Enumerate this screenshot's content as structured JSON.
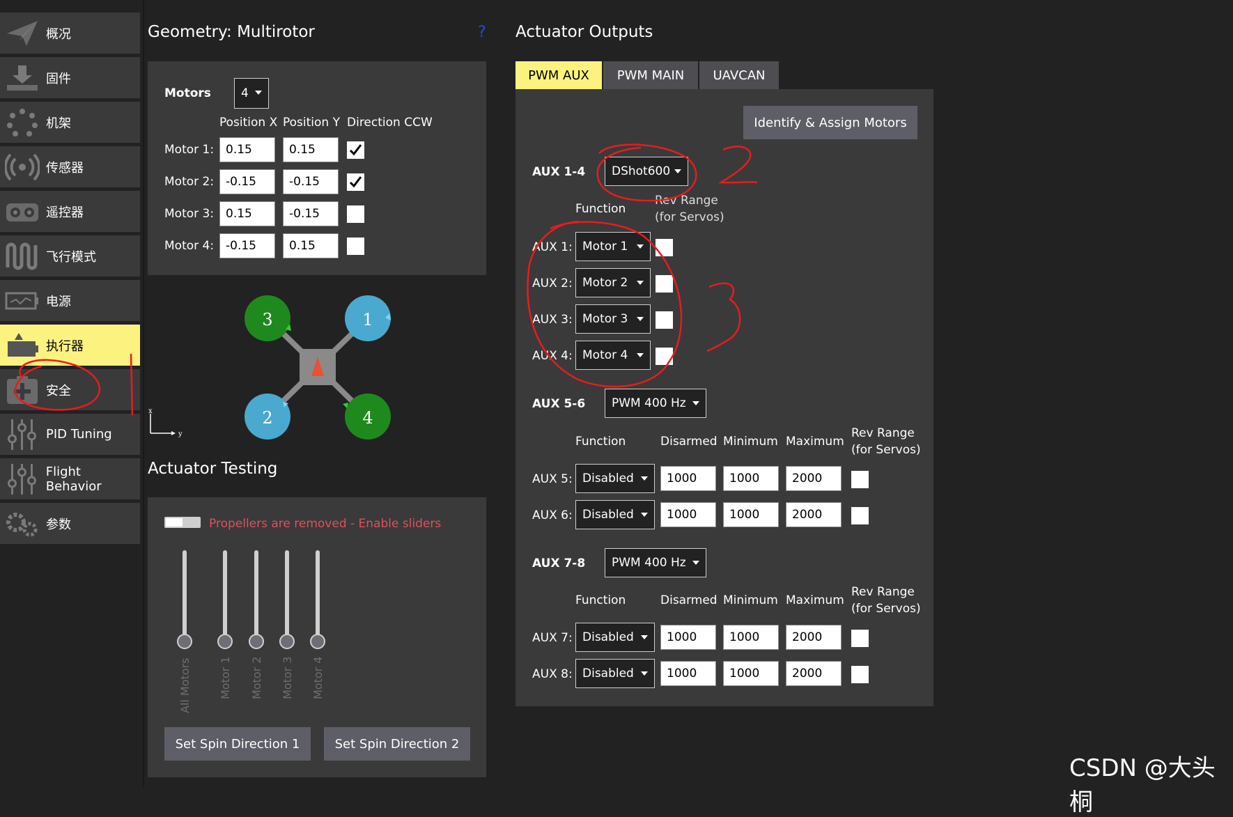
{
  "sidebar": {
    "items": [
      {
        "label": "概况",
        "icon": "paper-plane-icon"
      },
      {
        "label": "固件",
        "icon": "download-icon"
      },
      {
        "label": "机架",
        "icon": "airframe-icon"
      },
      {
        "label": "传感器",
        "icon": "radio-waves-icon"
      },
      {
        "label": "遥控器",
        "icon": "remote-controller-icon"
      },
      {
        "label": "飞行模式",
        "icon": "wave-icon"
      },
      {
        "label": "电源",
        "icon": "battery-icon"
      },
      {
        "label": "执行器",
        "icon": "actuator-icon",
        "active": true
      },
      {
        "label": "安全",
        "icon": "safety-plus-icon"
      },
      {
        "label": "PID Tuning",
        "icon": "sliders-icon"
      },
      {
        "label": "Flight Behavior",
        "icon": "sliders-icon"
      },
      {
        "label": "参数",
        "icon": "gears-icon"
      }
    ]
  },
  "geometry": {
    "title": "Geometry: Multirotor",
    "help": "?",
    "motors_label": "Motors",
    "motors_value": "4",
    "col_x": "Position X",
    "col_y": "Position Y",
    "col_ccw": "Direction CCW",
    "rows": [
      {
        "label": "Motor 1:",
        "x": "0.15",
        "y": "0.15",
        "ccw": true
      },
      {
        "label": "Motor 2:",
        "x": "-0.15",
        "y": "-0.15",
        "ccw": true
      },
      {
        "label": "Motor 3:",
        "x": "0.15",
        "y": "-0.15",
        "ccw": false
      },
      {
        "label": "Motor 4:",
        "x": "-0.15",
        "y": "0.15",
        "ccw": false
      }
    ],
    "diagram": {
      "rotors": [
        {
          "num": "3",
          "color": "#1e8a1e"
        },
        {
          "num": "1",
          "color": "#4aa9cf"
        },
        {
          "num": "2",
          "color": "#4aa9cf"
        },
        {
          "num": "4",
          "color": "#1e8a1e"
        }
      ],
      "axis_x": "x",
      "axis_y": "y"
    }
  },
  "testing": {
    "title": "Actuator Testing",
    "warning": "Propellers are removed - Enable sliders",
    "sliders": [
      "All Motors",
      "Motor 1",
      "Motor 2",
      "Motor 3",
      "Motor 4"
    ],
    "btn_dir1": "Set Spin Direction 1",
    "btn_dir2": "Set Spin Direction 2"
  },
  "outputs": {
    "title": "Actuator Outputs",
    "tabs": [
      "PWM AUX",
      "PWM MAIN",
      "UAVCAN"
    ],
    "identify_btn": "Identify & Assign Motors",
    "function_label": "Function",
    "rev_range": "Rev Range",
    "for_servos": "(for Servos)",
    "disarmed": "Disarmed",
    "minimum": "Minimum",
    "maximum": "Maximum",
    "group1": {
      "label": "AUX 1-4",
      "protocol": "DShot600",
      "rows": [
        {
          "label": "AUX 1:",
          "func": "Motor 1"
        },
        {
          "label": "AUX 2:",
          "func": "Motor 2"
        },
        {
          "label": "AUX 3:",
          "func": "Motor 3"
        },
        {
          "label": "AUX 4:",
          "func": "Motor 4"
        }
      ]
    },
    "group2": {
      "label": "AUX 5-6",
      "protocol": "PWM 400 Hz",
      "rows": [
        {
          "label": "AUX 5:",
          "func": "Disabled",
          "disarmed": "1000",
          "min": "1000",
          "max": "2000"
        },
        {
          "label": "AUX 6:",
          "func": "Disabled",
          "disarmed": "1000",
          "min": "1000",
          "max": "2000"
        }
      ]
    },
    "group3": {
      "label": "AUX 7-8",
      "protocol": "PWM 400 Hz",
      "rows": [
        {
          "label": "AUX 7:",
          "func": "Disabled",
          "disarmed": "1000",
          "min": "1000",
          "max": "2000"
        },
        {
          "label": "AUX 8:",
          "func": "Disabled",
          "disarmed": "1000",
          "min": "1000",
          "max": "2000"
        }
      ]
    }
  },
  "annotations": {
    "num2": "2",
    "num3": "3",
    "color": "#e81c1c"
  },
  "watermark": "CSDN @大头桐"
}
